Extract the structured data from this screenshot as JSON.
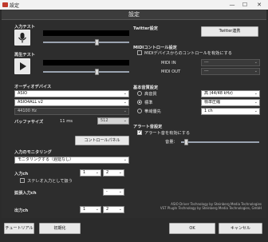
{
  "window": {
    "title": "設定",
    "minimize": "—",
    "maximize": "☐",
    "close": "✕"
  },
  "header": {
    "title": "設定"
  },
  "left": {
    "input_test": "入力テスト",
    "playback_test": "再生テスト",
    "audio_device": "オーディオデバイス",
    "device_api": "ASIO",
    "device_name": "ASIO4ALL v2",
    "sample_rate": "44100 Hz",
    "buffer_size_label": "バッファサイズ",
    "buffer_ms": "11 ms",
    "buffer_value": "512",
    "control_panel": "コントロールパネル",
    "monitoring_label": "入力のモニタリング",
    "monitoring_value": "モニタリングする（遅延なし）",
    "input_ch_label": "入力ch",
    "input_ch_1": "1",
    "input_ch_2": "2",
    "stereo_input": "ステレオ入力として扱う",
    "ext_input_label": "拡張入力ch",
    "ext_input_value": "-",
    "output_ch_label": "出力ch",
    "output_ch_1": "1",
    "output_ch_2": "2"
  },
  "right": {
    "twitter_label": "Twitter設定",
    "twitter_button": "Twitter連携",
    "midi_label": "MIDIコントロール設定",
    "midi_enable": "MIDIデバイスからのコントロールを有効にする",
    "midi_in": "MIDI IN",
    "midi_in_value": "---",
    "midi_out": "MIDI OUT",
    "midi_out_value": "---",
    "basic_quality": "基本音質設定",
    "quality_high": "高音質",
    "quality_std": "標準",
    "quality_low": "帯域優先",
    "quality_high_value": "高 (44/48 kHz)",
    "quality_std_value": "標準圧縮",
    "quality_low_value": "1 ch",
    "alert_label": "アラート音設定",
    "alert_enable": "アラート音を有効にする",
    "volume_label": "音量：",
    "volume_level": 0.04
  },
  "credits": {
    "line1": "ASIO Driver Technology by Steinberg Media Technologies",
    "line2": "VST PlugIn Technology by Steinberg Media Technologies, GmbH"
  },
  "footer": {
    "tutorial": "チュートリアル",
    "reset": "初期化",
    "ok": "OK",
    "cancel": "キャンセル"
  }
}
